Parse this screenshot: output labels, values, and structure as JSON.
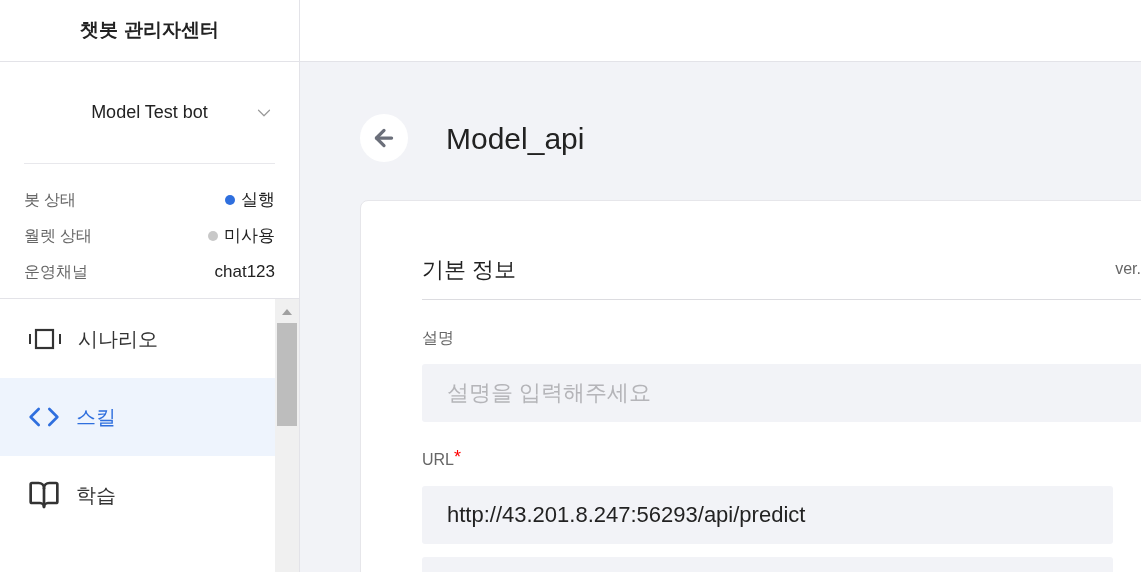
{
  "sidebar": {
    "title": "챗봇 관리자센터",
    "bot_selector": {
      "value": "Model Test bot"
    },
    "status": [
      {
        "label": "봇 상태",
        "value": "실행",
        "color": "#2f6fde"
      },
      {
        "label": "월렛 상태",
        "value": "미사용",
        "color": "#c8c8c8"
      },
      {
        "label": "운영채널",
        "value": "chat123"
      }
    ],
    "nav": [
      {
        "label": "시나리오",
        "kind": "scenario",
        "selected": false
      },
      {
        "label": "스킬",
        "kind": "skill",
        "selected": true
      },
      {
        "label": "학습",
        "kind": "learning",
        "selected": false
      }
    ]
  },
  "page": {
    "title": "Model_api",
    "section": {
      "title": "기본 정보",
      "version": "ver."
    },
    "fields": [
      {
        "label": "설명",
        "placeholder": "설명을 입력해주세요"
      },
      {
        "label": "URL",
        "required_mark": "*",
        "value": "http://43.201.8.247:56293/api/predict"
      }
    ]
  }
}
